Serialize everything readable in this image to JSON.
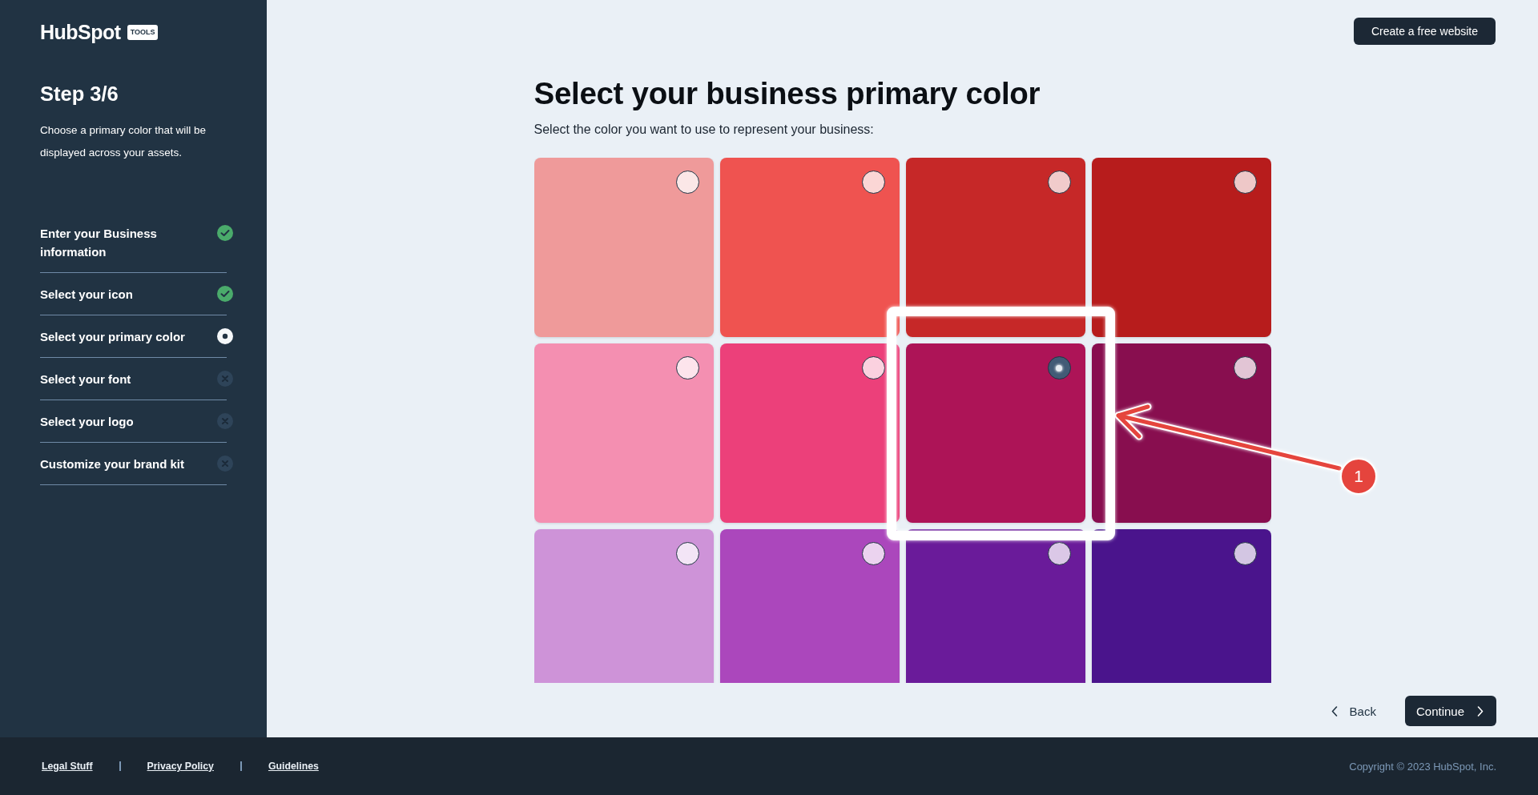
{
  "sidebar": {
    "logo": {
      "name": "HubSpot",
      "badge": "TOOLS"
    },
    "step_title": "Step 3/6",
    "description": "Choose a primary color that will be displayed across your assets.",
    "steps": [
      {
        "label": "Enter your Business information",
        "completed": true,
        "current": false
      },
      {
        "label": "Select your icon",
        "completed": true,
        "current": false
      },
      {
        "label": "Select your primary color",
        "completed": false,
        "current": true
      },
      {
        "label": "Select your font",
        "completed": false,
        "current": false
      },
      {
        "label": "Select your logo",
        "completed": false,
        "current": false
      },
      {
        "label": "Customize your brand kit",
        "completed": false,
        "current": false
      }
    ]
  },
  "header": {
    "button": "Create a free website"
  },
  "main": {
    "title": "Select your business primary color",
    "subtitle": "Select the color you want to use to represent your business:",
    "swatches": [
      {
        "color": "#ef9a9a",
        "selected": false
      },
      {
        "color": "#ef5350",
        "selected": false
      },
      {
        "color": "#c62828",
        "selected": false
      },
      {
        "color": "#b71c1c",
        "selected": false
      },
      {
        "color": "#f48fb1",
        "selected": false
      },
      {
        "color": "#ec407a",
        "selected": false
      },
      {
        "color": "#ad1457",
        "selected": true
      },
      {
        "color": "#880e4f",
        "selected": false
      },
      {
        "color": "#ce93d8",
        "selected": false
      },
      {
        "color": "#ab47bc",
        "selected": false
      },
      {
        "color": "#6a1b9a",
        "selected": false
      },
      {
        "color": "#4a148c",
        "selected": false
      }
    ]
  },
  "navigation": {
    "back": "Back",
    "continue": "Continue"
  },
  "footer": {
    "links": [
      "Legal Stuff",
      "Privacy Policy",
      "Guidelines"
    ],
    "copyright": "Copyright © 2023 HubSpot, Inc."
  },
  "annotation": {
    "label": "1"
  }
}
